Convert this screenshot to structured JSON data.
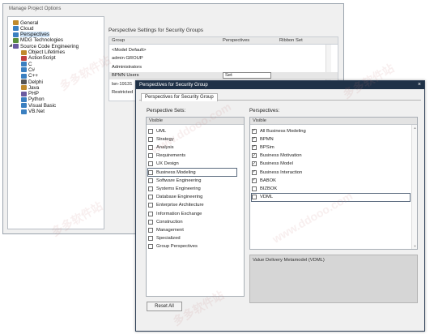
{
  "bg_window": {
    "title": "Manage Project Options",
    "tree": [
      {
        "label": "General",
        "level": 0,
        "color": "#c08a2c"
      },
      {
        "label": "Cloud",
        "level": 0,
        "color": "#3a7fc0"
      },
      {
        "label": "Perspectives",
        "level": 0,
        "color": "#3a7fc0",
        "selected": true
      },
      {
        "label": "MDG Technologies",
        "level": 0,
        "color": "#5a8f3c"
      },
      {
        "label": "Source Code Engineering",
        "level": 0,
        "color": "#6a5aa0",
        "expanded": true
      },
      {
        "label": "Object Lifetimes",
        "level": 1,
        "color": "#c08a2c"
      },
      {
        "label": "ActionScript",
        "level": 1,
        "color": "#c04040"
      },
      {
        "label": "C",
        "level": 1,
        "color": "#3a7fc0"
      },
      {
        "label": "C#",
        "level": 1,
        "color": "#3a7fc0"
      },
      {
        "label": "C++",
        "level": 1,
        "color": "#3a7fc0"
      },
      {
        "label": "Delphi",
        "level": 1,
        "color": "#555555"
      },
      {
        "label": "Java",
        "level": 1,
        "color": "#c08a2c"
      },
      {
        "label": "PHP",
        "level": 1,
        "color": "#6a5aa0"
      },
      {
        "label": "Python",
        "level": 1,
        "color": "#3a7fc0"
      },
      {
        "label": "Visual Basic",
        "level": 1,
        "color": "#3a7fc0"
      },
      {
        "label": "VB.Net",
        "level": 1,
        "color": "#3a7fc0"
      }
    ],
    "right_title": "Perspective Settings for Security Groups",
    "grid_headers": [
      "Group",
      "Perspectives",
      "Ribbon Set"
    ],
    "grid_rows": [
      {
        "group": "<Model Default>",
        "perspectives": ""
      },
      {
        "group": "admin GROUP",
        "perspectives": ""
      },
      {
        "group": "Administrators",
        "perspectives": ""
      },
      {
        "group": "BPMN Users",
        "perspectives": "Set",
        "highlight": true
      },
      {
        "group": "lsn-19131",
        "perspectives": ""
      },
      {
        "group": "Restricted",
        "perspectives": ""
      }
    ]
  },
  "dialog": {
    "title": "Perspectives for Security Group",
    "close_icon": "×",
    "tab_label": "Perspectives for Security Group",
    "left_label": "Perspective Sets:",
    "right_label": "Perspectives:",
    "list_header": "Visible",
    "perspective_sets": [
      {
        "label": "UML",
        "checked": false
      },
      {
        "label": "Strategy",
        "checked": false
      },
      {
        "label": "Analysis",
        "checked": false
      },
      {
        "label": "Requirements",
        "checked": false
      },
      {
        "label": "UX Design",
        "checked": false
      },
      {
        "label": "Business Modeling",
        "checked": false,
        "focused": true
      },
      {
        "label": "Software Engineering",
        "checked": false
      },
      {
        "label": "Systems Engineering",
        "checked": false
      },
      {
        "label": "Database Engineering",
        "checked": false
      },
      {
        "label": "Enterprise Architecture",
        "checked": false
      },
      {
        "label": "Information Exchange",
        "checked": false
      },
      {
        "label": "Construction",
        "checked": false
      },
      {
        "label": "Management",
        "checked": false
      },
      {
        "label": "Specialized",
        "checked": false
      },
      {
        "label": "Group Perspectives",
        "checked": false
      }
    ],
    "perspectives": [
      {
        "label": "All Business Modeling",
        "checked": true
      },
      {
        "label": "BPMN",
        "checked": true
      },
      {
        "label": "BPSim",
        "checked": true
      },
      {
        "label": "Business Motivation",
        "checked": true
      },
      {
        "label": "Business Model",
        "checked": true
      },
      {
        "label": "Business Interaction",
        "checked": true
      },
      {
        "label": "BABOK",
        "checked": true
      },
      {
        "label": "BIZBOK",
        "checked": false
      },
      {
        "label": "VDML",
        "checked": false,
        "focused": true
      }
    ],
    "description": "Value Delivery Metamodel (VDML)",
    "reset_button": "Reset All"
  },
  "watermarks": [
    "多多软件站",
    "www.ddooo.com"
  ]
}
